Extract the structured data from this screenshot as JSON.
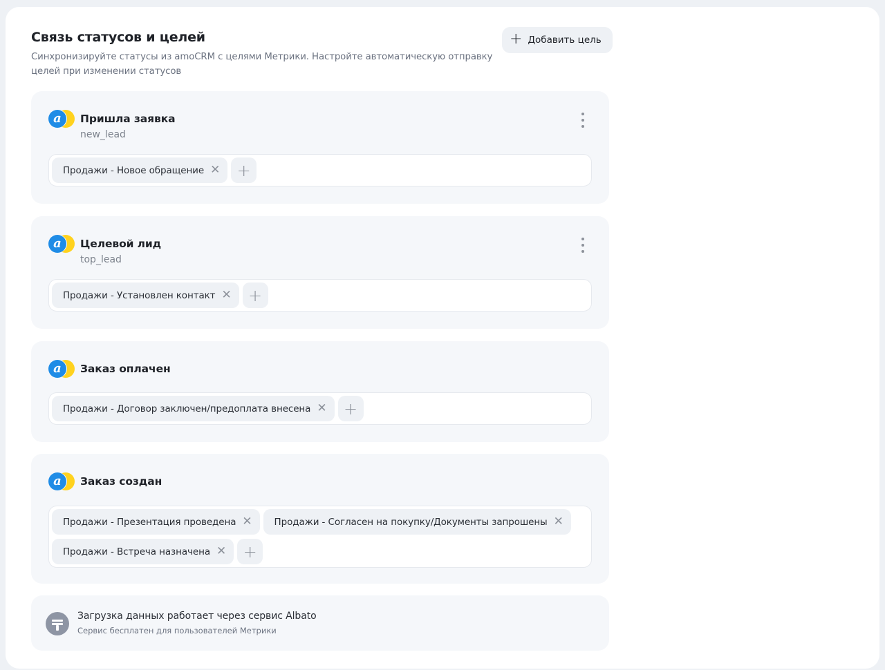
{
  "header": {
    "title": "Связь статусов и целей",
    "description": "Синхронизируйте статусы из amoCRM с целями Метрики. Настройте автоматическую отправку целей при изменении статусов",
    "add_goal_label": "Добавить цель",
    "add_goal_icon": "plus-icon"
  },
  "statuses": [
    {
      "name": "Пришла заявка",
      "code": "new_lead",
      "goals": [
        "Продажи - Новое обращение"
      ]
    },
    {
      "name": "Целевой лид",
      "code": "top_lead",
      "goals": [
        "Продажи - Установлен контакт"
      ]
    },
    {
      "name": "Заказ оплачен",
      "code": "",
      "goals": [
        "Продажи - Договор заключен/предоплата внесена"
      ]
    },
    {
      "name": "Заказ создан",
      "code": "",
      "goals": [
        "Продажи - Презентация проведена",
        "Продажи - Согласен на покупку/Документы запрошены",
        "Продажи - Встреча назначена"
      ]
    }
  ],
  "logo": {
    "letter": "a",
    "icon": "amocrm-logo-icon",
    "colors": {
      "blue": "#1f8ce6",
      "yellow": "#ffd21e"
    }
  },
  "info": {
    "title": "Загрузка данных работает через сервис Albato",
    "subtitle": "Сервис бесплатен для пользователей Метрики",
    "icon": "albato-icon"
  },
  "icons": {
    "remove": "✕",
    "add": "+"
  }
}
